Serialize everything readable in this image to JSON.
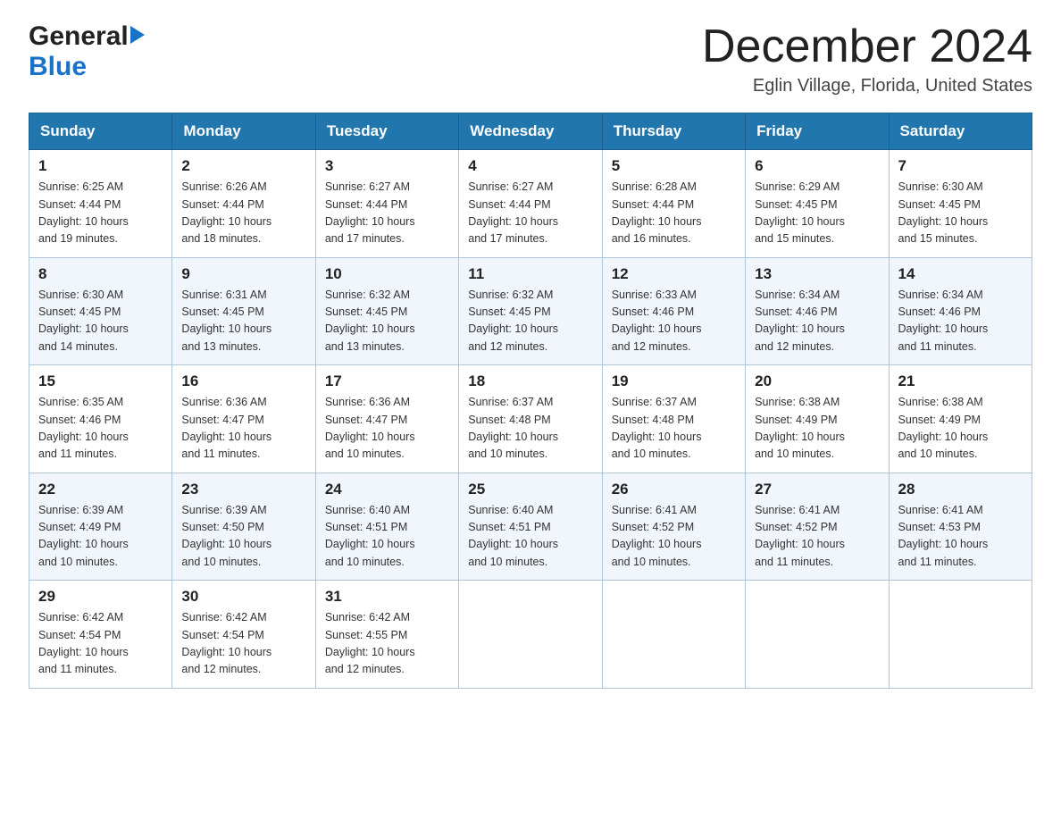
{
  "logo": {
    "general": "General",
    "blue": "Blue"
  },
  "title": "December 2024",
  "location": "Eglin Village, Florida, United States",
  "weekdays": [
    "Sunday",
    "Monday",
    "Tuesday",
    "Wednesday",
    "Thursday",
    "Friday",
    "Saturday"
  ],
  "weeks": [
    [
      {
        "day": "1",
        "sunrise": "6:25 AM",
        "sunset": "4:44 PM",
        "daylight": "10 hours and 19 minutes."
      },
      {
        "day": "2",
        "sunrise": "6:26 AM",
        "sunset": "4:44 PM",
        "daylight": "10 hours and 18 minutes."
      },
      {
        "day": "3",
        "sunrise": "6:27 AM",
        "sunset": "4:44 PM",
        "daylight": "10 hours and 17 minutes."
      },
      {
        "day": "4",
        "sunrise": "6:27 AM",
        "sunset": "4:44 PM",
        "daylight": "10 hours and 17 minutes."
      },
      {
        "day": "5",
        "sunrise": "6:28 AM",
        "sunset": "4:44 PM",
        "daylight": "10 hours and 16 minutes."
      },
      {
        "day": "6",
        "sunrise": "6:29 AM",
        "sunset": "4:45 PM",
        "daylight": "10 hours and 15 minutes."
      },
      {
        "day": "7",
        "sunrise": "6:30 AM",
        "sunset": "4:45 PM",
        "daylight": "10 hours and 15 minutes."
      }
    ],
    [
      {
        "day": "8",
        "sunrise": "6:30 AM",
        "sunset": "4:45 PM",
        "daylight": "10 hours and 14 minutes."
      },
      {
        "day": "9",
        "sunrise": "6:31 AM",
        "sunset": "4:45 PM",
        "daylight": "10 hours and 13 minutes."
      },
      {
        "day": "10",
        "sunrise": "6:32 AM",
        "sunset": "4:45 PM",
        "daylight": "10 hours and 13 minutes."
      },
      {
        "day": "11",
        "sunrise": "6:32 AM",
        "sunset": "4:45 PM",
        "daylight": "10 hours and 12 minutes."
      },
      {
        "day": "12",
        "sunrise": "6:33 AM",
        "sunset": "4:46 PM",
        "daylight": "10 hours and 12 minutes."
      },
      {
        "day": "13",
        "sunrise": "6:34 AM",
        "sunset": "4:46 PM",
        "daylight": "10 hours and 12 minutes."
      },
      {
        "day": "14",
        "sunrise": "6:34 AM",
        "sunset": "4:46 PM",
        "daylight": "10 hours and 11 minutes."
      }
    ],
    [
      {
        "day": "15",
        "sunrise": "6:35 AM",
        "sunset": "4:46 PM",
        "daylight": "10 hours and 11 minutes."
      },
      {
        "day": "16",
        "sunrise": "6:36 AM",
        "sunset": "4:47 PM",
        "daylight": "10 hours and 11 minutes."
      },
      {
        "day": "17",
        "sunrise": "6:36 AM",
        "sunset": "4:47 PM",
        "daylight": "10 hours and 10 minutes."
      },
      {
        "day": "18",
        "sunrise": "6:37 AM",
        "sunset": "4:48 PM",
        "daylight": "10 hours and 10 minutes."
      },
      {
        "day": "19",
        "sunrise": "6:37 AM",
        "sunset": "4:48 PM",
        "daylight": "10 hours and 10 minutes."
      },
      {
        "day": "20",
        "sunrise": "6:38 AM",
        "sunset": "4:49 PM",
        "daylight": "10 hours and 10 minutes."
      },
      {
        "day": "21",
        "sunrise": "6:38 AM",
        "sunset": "4:49 PM",
        "daylight": "10 hours and 10 minutes."
      }
    ],
    [
      {
        "day": "22",
        "sunrise": "6:39 AM",
        "sunset": "4:49 PM",
        "daylight": "10 hours and 10 minutes."
      },
      {
        "day": "23",
        "sunrise": "6:39 AM",
        "sunset": "4:50 PM",
        "daylight": "10 hours and 10 minutes."
      },
      {
        "day": "24",
        "sunrise": "6:40 AM",
        "sunset": "4:51 PM",
        "daylight": "10 hours and 10 minutes."
      },
      {
        "day": "25",
        "sunrise": "6:40 AM",
        "sunset": "4:51 PM",
        "daylight": "10 hours and 10 minutes."
      },
      {
        "day": "26",
        "sunrise": "6:41 AM",
        "sunset": "4:52 PM",
        "daylight": "10 hours and 10 minutes."
      },
      {
        "day": "27",
        "sunrise": "6:41 AM",
        "sunset": "4:52 PM",
        "daylight": "10 hours and 11 minutes."
      },
      {
        "day": "28",
        "sunrise": "6:41 AM",
        "sunset": "4:53 PM",
        "daylight": "10 hours and 11 minutes."
      }
    ],
    [
      {
        "day": "29",
        "sunrise": "6:42 AM",
        "sunset": "4:54 PM",
        "daylight": "10 hours and 11 minutes."
      },
      {
        "day": "30",
        "sunrise": "6:42 AM",
        "sunset": "4:54 PM",
        "daylight": "10 hours and 12 minutes."
      },
      {
        "day": "31",
        "sunrise": "6:42 AM",
        "sunset": "4:55 PM",
        "daylight": "10 hours and 12 minutes."
      },
      null,
      null,
      null,
      null
    ]
  ],
  "labels": {
    "sunrise": "Sunrise:",
    "sunset": "Sunset:",
    "daylight": "Daylight:"
  }
}
